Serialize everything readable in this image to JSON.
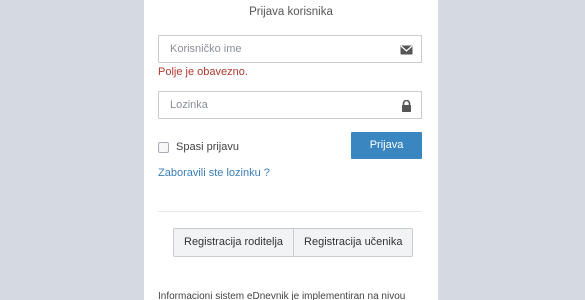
{
  "form": {
    "title": "Prijava korisnika",
    "username": {
      "placeholder": "Korisničko ime",
      "icon": "envelope-icon",
      "error": "Polje je obavezno."
    },
    "password": {
      "placeholder": "Lozinka",
      "icon": "lock-icon"
    },
    "remember_label": "Spasi prijavu",
    "login_button": "Prijava",
    "forgot_link": "Zaboravili ste lozinku ?"
  },
  "registration": {
    "parent_button": "Registracija roditelja",
    "student_button": "Registracija učenika"
  },
  "footer": {
    "text": "Informacioni sistem eDnevnik je implementiran na nivou"
  },
  "colors": {
    "background": "#d5d9e0",
    "panel": "#ffffff",
    "primary": "#3a86c0",
    "error": "#b03a2e",
    "link": "#3a7fb8"
  }
}
